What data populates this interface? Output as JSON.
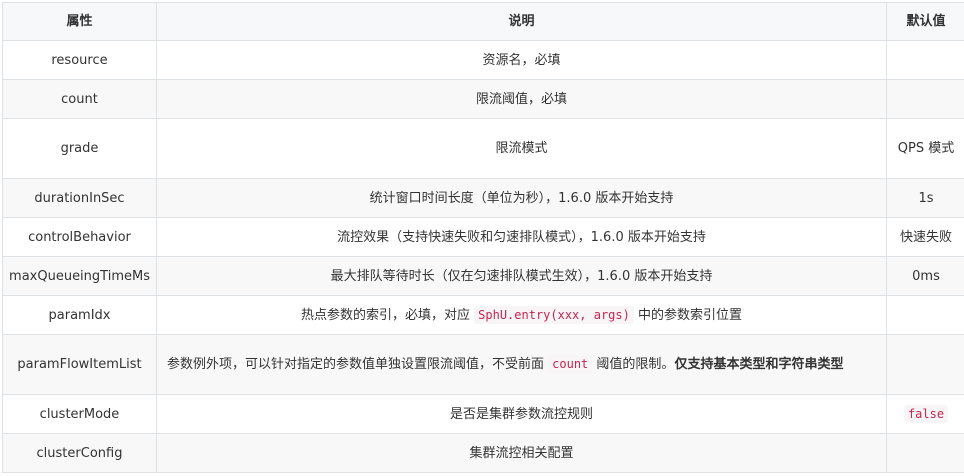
{
  "table": {
    "headers": {
      "attribute": "属性",
      "description": "说明",
      "default": "默认值"
    },
    "rows": [
      {
        "attribute": "resource",
        "description": "资源名，必填",
        "default": ""
      },
      {
        "attribute": "count",
        "description": "限流阈值，必填",
        "default": ""
      },
      {
        "attribute": "grade",
        "description": "限流模式",
        "default": "QPS 模式"
      },
      {
        "attribute": "durationInSec",
        "description": "统计窗口时间长度（单位为秒），1.6.0 版本开始支持",
        "default": "1s"
      },
      {
        "attribute": "controlBehavior",
        "description": "流控效果（支持快速失败和匀速排队模式），1.6.0 版本开始支持",
        "default": "快速失败"
      },
      {
        "attribute": "maxQueueingTimeMs",
        "description": "最大排队等待时长（仅在匀速排队模式生效），1.6.0 版本开始支持",
        "default": "0ms"
      },
      {
        "attribute": "paramIdx",
        "description_before": "热点参数的索引，必填，对应",
        "description_code": "SphU.entry(xxx, args)",
        "description_after": "中的参数索引位置",
        "default": ""
      },
      {
        "attribute": "paramFlowItemList",
        "description_before": "参数例外项，可以针对指定的参数值单独设置限流阈值，不受前面",
        "description_code": "count",
        "description_after": "阈值的限制。",
        "description_bold": "仅支持基本类型和字符串类型",
        "default": ""
      },
      {
        "attribute": "clusterMode",
        "description": "是否是集群参数流控规则",
        "default_code": "false"
      },
      {
        "attribute": "clusterConfig",
        "description": "集群流控相关配置",
        "default": ""
      }
    ]
  }
}
